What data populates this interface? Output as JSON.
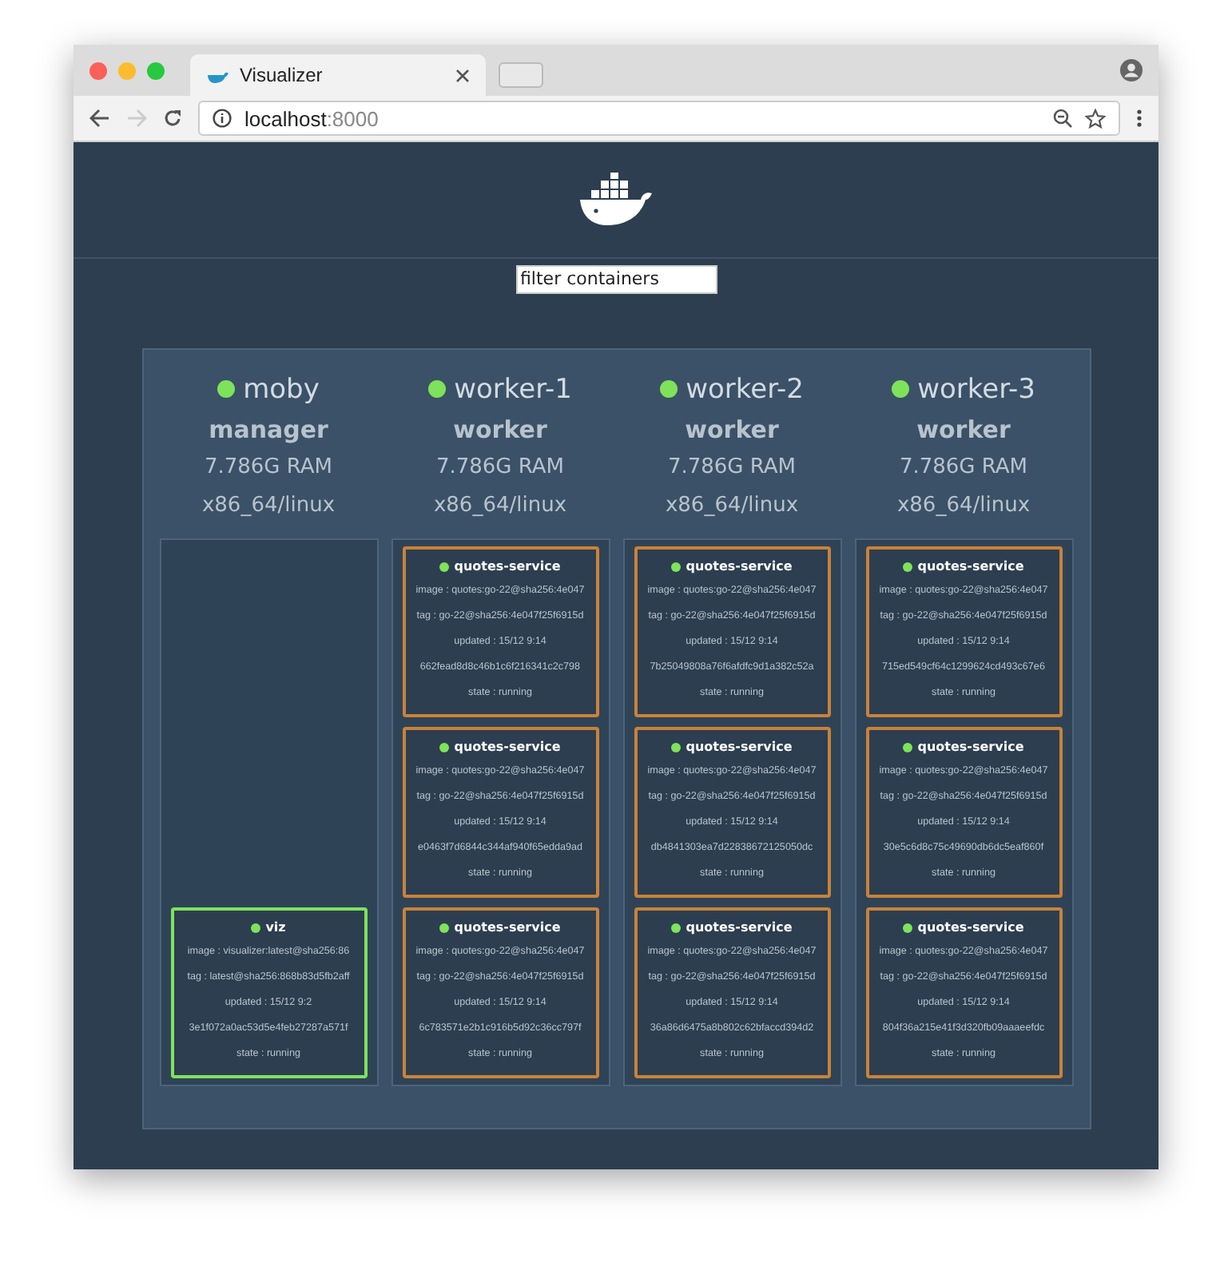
{
  "browser": {
    "tab_title": "Visualizer",
    "url_host": "localhost",
    "url_port": ":8000"
  },
  "filter": {
    "placeholder": "filter containers"
  },
  "nodes": [
    {
      "name": "moby",
      "role": "manager",
      "ram": "7.786G RAM",
      "arch": "x86_64/linux",
      "containers": [
        {
          "name": "viz",
          "color": "#7ee35a",
          "image": "image : visualizer:latest@sha256:86",
          "tag": "tag : latest@sha256:868b83d5fb2aff",
          "updated": "updated : 15/12 9:2",
          "id": "3e1f072a0ac53d5e4feb27287a571f",
          "state": "state : running"
        }
      ]
    },
    {
      "name": "worker-1",
      "role": "worker",
      "ram": "7.786G RAM",
      "arch": "x86_64/linux",
      "containers": [
        {
          "name": "quotes-service",
          "color": "#c8823a",
          "image": "image : quotes:go-22@sha256:4e047",
          "tag": "tag : go-22@sha256:4e047f25f6915d",
          "updated": "updated : 15/12 9:14",
          "id": "662fead8d8c46b1c6f216341c2c798",
          "state": "state : running"
        },
        {
          "name": "quotes-service",
          "color": "#c8823a",
          "image": "image : quotes:go-22@sha256:4e047",
          "tag": "tag : go-22@sha256:4e047f25f6915d",
          "updated": "updated : 15/12 9:14",
          "id": "e0463f7d6844c344af940f65edda9ad",
          "state": "state : running"
        },
        {
          "name": "quotes-service",
          "color": "#c8823a",
          "image": "image : quotes:go-22@sha256:4e047",
          "tag": "tag : go-22@sha256:4e047f25f6915d",
          "updated": "updated : 15/12 9:14",
          "id": "6c783571e2b1c916b5d92c36cc797f",
          "state": "state : running"
        }
      ]
    },
    {
      "name": "worker-2",
      "role": "worker",
      "ram": "7.786G RAM",
      "arch": "x86_64/linux",
      "containers": [
        {
          "name": "quotes-service",
          "color": "#c8823a",
          "image": "image : quotes:go-22@sha256:4e047",
          "tag": "tag : go-22@sha256:4e047f25f6915d",
          "updated": "updated : 15/12 9:14",
          "id": "7b25049808a76f6afdfc9d1a382c52a",
          "state": "state : running"
        },
        {
          "name": "quotes-service",
          "color": "#c8823a",
          "image": "image : quotes:go-22@sha256:4e047",
          "tag": "tag : go-22@sha256:4e047f25f6915d",
          "updated": "updated : 15/12 9:14",
          "id": "db4841303ea7d22838672125050dc",
          "state": "state : running"
        },
        {
          "name": "quotes-service",
          "color": "#c8823a",
          "image": "image : quotes:go-22@sha256:4e047",
          "tag": "tag : go-22@sha256:4e047f25f6915d",
          "updated": "updated : 15/12 9:14",
          "id": "36a86d6475a8b802c62bfaccd394d2",
          "state": "state : running"
        }
      ]
    },
    {
      "name": "worker-3",
      "role": "worker",
      "ram": "7.786G RAM",
      "arch": "x86_64/linux",
      "containers": [
        {
          "name": "quotes-service",
          "color": "#c8823a",
          "image": "image : quotes:go-22@sha256:4e047",
          "tag": "tag : go-22@sha256:4e047f25f6915d",
          "updated": "updated : 15/12 9:14",
          "id": "715ed549cf64c1299624cd493c67e6",
          "state": "state : running"
        },
        {
          "name": "quotes-service",
          "color": "#c8823a",
          "image": "image : quotes:go-22@sha256:4e047",
          "tag": "tag : go-22@sha256:4e047f25f6915d",
          "updated": "updated : 15/12 9:14",
          "id": "30e5c6d8c75c49690db6dc5eaf860f",
          "state": "state : running"
        },
        {
          "name": "quotes-service",
          "color": "#c8823a",
          "image": "image : quotes:go-22@sha256:4e047",
          "tag": "tag : go-22@sha256:4e047f25f6915d",
          "updated": "updated : 15/12 9:14",
          "id": "804f36a215e41f3d320fb09aaaeefdc",
          "state": "state : running"
        }
      ]
    }
  ]
}
